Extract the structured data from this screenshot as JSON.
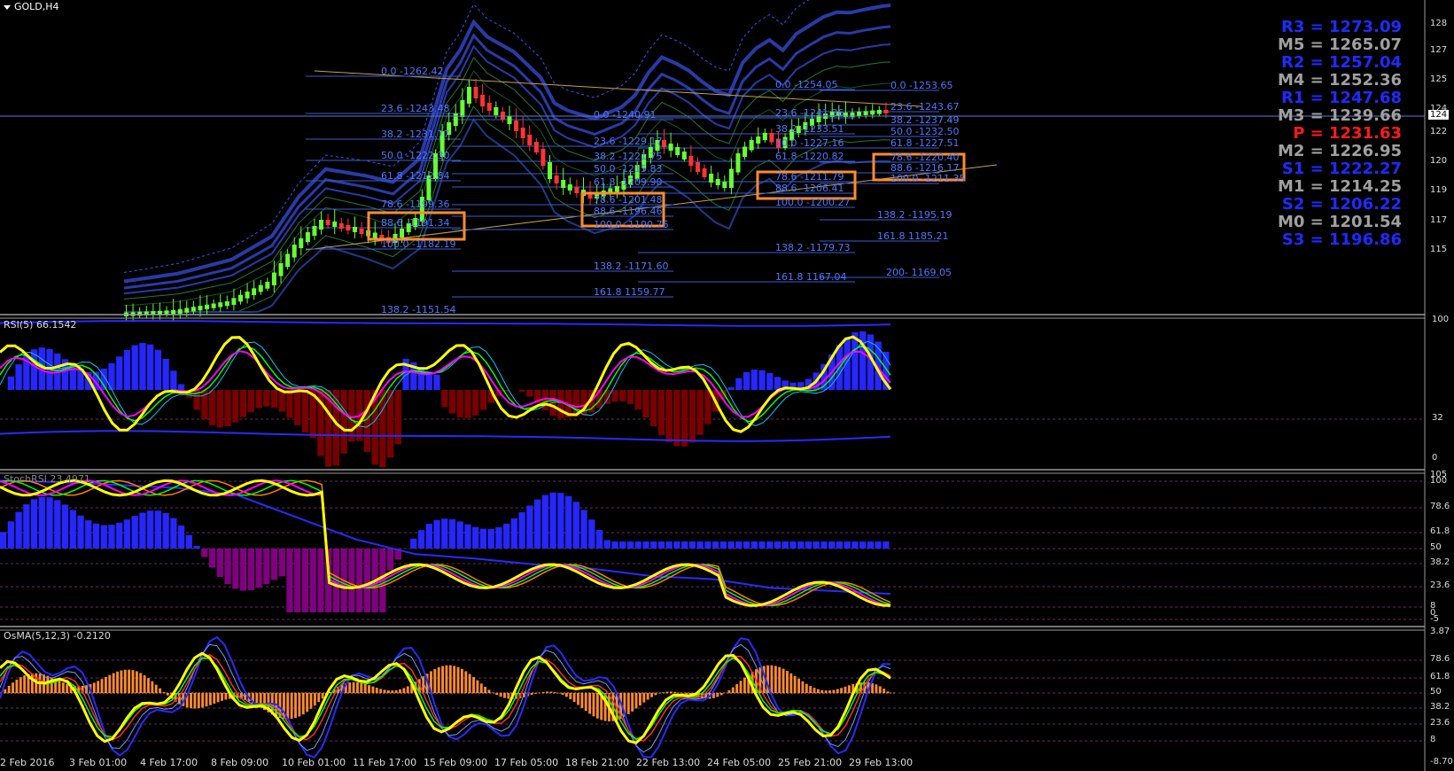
{
  "symbol": {
    "label": "GOLD,H4"
  },
  "panes": {
    "rsi_label": "RSI(5) 66.1542",
    "stoch_label": "StochRSI 23.4971",
    "osma_label": "OsMA(5,12,3) -0.2120"
  },
  "pivots": [
    {
      "label": "R3 = 1273.09",
      "color": "#1f2bff"
    },
    {
      "label": "M5 = 1265.07",
      "color": "#a0a0a0"
    },
    {
      "label": "R2 = 1257.04",
      "color": "#1f2bff"
    },
    {
      "label": "M4 = 1252.36",
      "color": "#a0a0a0"
    },
    {
      "label": "R1 = 1247.68",
      "color": "#1f2bff"
    },
    {
      "label": "M3 = 1239.66",
      "color": "#a0a0a0"
    },
    {
      "label": "P   = 1231.63",
      "color": "#ff1a1a"
    },
    {
      "label": "M2 = 1226.95",
      "color": "#a0a0a0"
    },
    {
      "label": "S1 = 1222.27",
      "color": "#1f2bff"
    },
    {
      "label": "M1 = 1214.25",
      "color": "#a0a0a0"
    },
    {
      "label": "S2 = 1206.22",
      "color": "#1f2bff"
    },
    {
      "label": "M0 = 1201.54",
      "color": "#a0a0a0"
    },
    {
      "label": "S3 = 1196.86",
      "color": "#1f2bff"
    }
  ],
  "price_axis": [
    "128",
    "127",
    "125",
    "124",
    "122",
    "120",
    "119",
    "117",
    "115"
  ],
  "price_tag": "124",
  "rsi_axis": [
    "100",
    "32",
    "0"
  ],
  "stoch_axis": [
    "105",
    "100",
    "78.6",
    "61.8",
    "50",
    "38.2",
    "23.6",
    "8",
    "0",
    "-5"
  ],
  "osma_axis": [
    "3.87",
    "78.6",
    "61.8",
    "50",
    "38.2",
    "23.6",
    "8",
    "-8.70"
  ],
  "time_axis": [
    "2 Feb 2016",
    "3 Feb 01:00",
    "4 Feb 17:00",
    "8 Feb 09:00",
    "10 Feb 01:00",
    "11 Feb 17:00",
    "15 Feb 09:00",
    "17 Feb 05:00",
    "18 Feb 21:00",
    "22 Feb 13:00",
    "24 Feb 05:00",
    "25 Feb 21:00",
    "29 Feb 13:00"
  ],
  "fib_labels": [
    "0.0 -1262.42",
    "23.6 -1243.48",
    "38.2 -1231.77",
    "50.0 -1222.30",
    "61.8 -1212.84",
    "78.6 -1199.36",
    "88.6 -1191.34",
    "100.0 -1182.19",
    "138.2 -1151.54",
    "0.0 -1240.91",
    "23.6 -1229.17",
    "38.2 -1221.75",
    "50.0 -1215.83",
    "61.8 -1209.90",
    "78.6 -1201.48",
    "88.6 -1196.46",
    "100.0 -1190.76",
    "138.2 -1171.60",
    "161.8 1159.77",
    "0.0 -1254.05",
    "23.6 -1241.36",
    "38.2 -1233.51",
    "50.0 -1227.16",
    "61.8 -1220.82",
    "78.6 -1211.79",
    "88.6 -1206.41",
    "100.0 -1200.27",
    "138.2 -1179.73",
    "161.8 1167.04",
    "0.0 -1253.65",
    "23.6 -1243.67",
    "38.2 -1237.49",
    "50.0 -1232.50",
    "61.8 -1227.51",
    "78.6 -1220.40",
    "88.6 -1216.17",
    "100.0 -1211.35",
    "138.2 -1195.19",
    "161.8 1185.21",
    "200- 1169.05"
  ],
  "colors": {
    "background": "#000000",
    "bull_candle": "#66ff33",
    "bear_candle": "#ff3333",
    "fib_text": "#4f78ff",
    "highlight_box": "#ff8c2e",
    "hist_blue": "#2626ff",
    "hist_maroon": "#7a0000",
    "hist_purple": "#800080",
    "rsi_line": "#ffff00"
  }
}
